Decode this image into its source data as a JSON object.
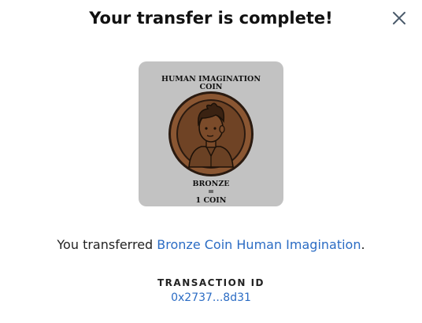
{
  "modal": {
    "title": "Your transfer is complete!",
    "close_icon": "close-icon"
  },
  "coin_image": {
    "top_line_1": "HUMAN IMAGINATION",
    "top_line_2": "COIN",
    "bottom_line_1": "BRONZE",
    "bottom_line_2": "=",
    "bottom_line_3": "1 COIN",
    "background_color": "#c2c2c2",
    "coin_color": "#7a4a2a"
  },
  "message": {
    "prefix": "You transferred ",
    "item_link": "Bronze Coin Human Imagination",
    "suffix": "."
  },
  "transaction": {
    "label": "TRANSACTION ID",
    "id": "0x2737...8d31"
  },
  "colors": {
    "link": "#2b6cc4",
    "text": "#222222"
  }
}
